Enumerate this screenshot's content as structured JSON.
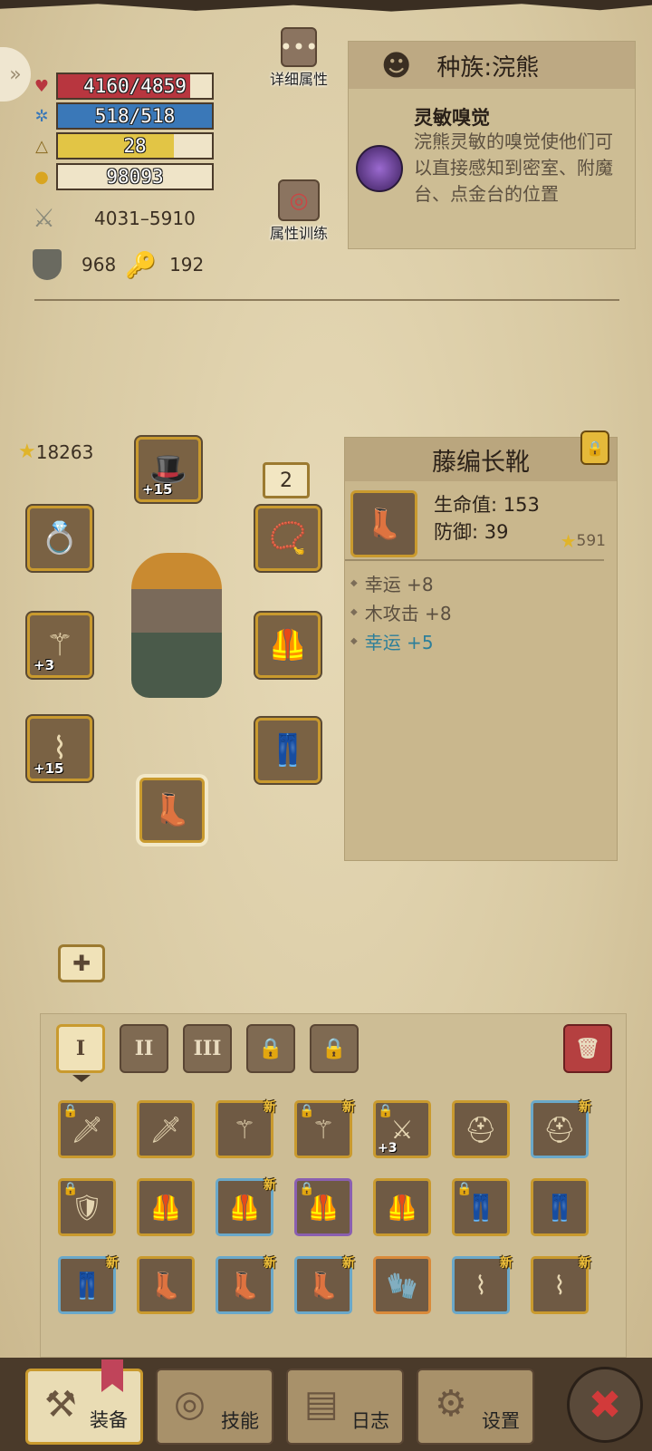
{
  "stats": {
    "hp": {
      "text": "4160/4859",
      "fraction": 0.856,
      "color": "#b8363f"
    },
    "mp": {
      "text": "518/518",
      "fraction": 1.0,
      "color": "#3a78b8"
    },
    "level": {
      "text": "28",
      "fraction": 0.75,
      "color": "#e2c545"
    },
    "gold": {
      "text": "98093"
    },
    "attack": "4031–5910",
    "armor": "968",
    "resist": "192"
  },
  "buttons": {
    "detail_attrs": "详细属性",
    "attr_training": "属性训练",
    "detail_icon": "•••"
  },
  "race": {
    "title": "种族:浣熊",
    "skill_name": "灵敏嗅觉",
    "skill_desc": "浣熊灵敏的嗅觉使他们可以直接感知到密室、附魔台、点金台的位置"
  },
  "character": {
    "power": "18263",
    "level_badge": "2"
  },
  "equipment_slots": [
    {
      "slot": "head",
      "icon": "hat-icon",
      "plus": "+15"
    },
    {
      "slot": "ring",
      "icon": "ring-icon",
      "plus": ""
    },
    {
      "slot": "necklace",
      "icon": "necklace-icon",
      "plus": ""
    },
    {
      "slot": "weapon",
      "icon": "staff-icon",
      "plus": "+3"
    },
    {
      "slot": "armor",
      "icon": "armor-icon",
      "plus": ""
    },
    {
      "slot": "bracer",
      "icon": "bracer-icon",
      "plus": "+15"
    },
    {
      "slot": "legs",
      "icon": "pants-icon",
      "plus": ""
    },
    {
      "slot": "boots",
      "icon": "boots-icon",
      "plus": ""
    }
  ],
  "selected_item": {
    "name": "藤编长靴",
    "stat1": "生命值: 153",
    "stat2": "防御: 39",
    "score": "591",
    "affixes": [
      "幸运 +8",
      "木攻击 +8",
      "幸运 +5"
    ]
  },
  "inventory": {
    "tabs": [
      "I",
      "II",
      "III"
    ],
    "new_label": "新",
    "items": [
      {
        "icon": "sword-icon",
        "border": "gold",
        "locked": true,
        "new": false,
        "plus": ""
      },
      {
        "icon": "sword-icon",
        "border": "gold",
        "locked": false,
        "new": false,
        "plus": ""
      },
      {
        "icon": "staff-icon",
        "border": "gold",
        "locked": false,
        "new": true,
        "plus": ""
      },
      {
        "icon": "staff-icon",
        "border": "gold",
        "locked": true,
        "new": true,
        "plus": ""
      },
      {
        "icon": "blade-icon",
        "border": "gold",
        "locked": true,
        "new": false,
        "plus": "+3"
      },
      {
        "icon": "helmet-icon",
        "border": "gold",
        "locked": false,
        "new": false,
        "plus": ""
      },
      {
        "icon": "helmet-icon",
        "border": "blue",
        "locked": false,
        "new": true,
        "plus": ""
      },
      {
        "icon": "pauldron-icon",
        "border": "gold",
        "locked": true,
        "new": false,
        "plus": ""
      },
      {
        "icon": "armor-icon",
        "border": "gold",
        "locked": false,
        "new": false,
        "plus": ""
      },
      {
        "icon": "armor-icon",
        "border": "blue",
        "locked": false,
        "new": true,
        "plus": ""
      },
      {
        "icon": "armor-icon",
        "border": "purple",
        "locked": true,
        "new": false,
        "plus": ""
      },
      {
        "icon": "armor-icon",
        "border": "gold",
        "locked": false,
        "new": false,
        "plus": ""
      },
      {
        "icon": "pants-icon",
        "border": "gold",
        "locked": true,
        "new": false,
        "plus": ""
      },
      {
        "icon": "pants-icon",
        "border": "gold",
        "locked": false,
        "new": false,
        "plus": ""
      },
      {
        "icon": "pants-icon",
        "border": "blue",
        "locked": false,
        "new": true,
        "plus": ""
      },
      {
        "icon": "boots-icon",
        "border": "gold",
        "locked": false,
        "new": false,
        "plus": ""
      },
      {
        "icon": "boots-icon",
        "border": "blue",
        "locked": false,
        "new": true,
        "plus": ""
      },
      {
        "icon": "boots-icon",
        "border": "blue",
        "locked": false,
        "new": true,
        "plus": ""
      },
      {
        "icon": "gauntlet-icon",
        "border": "orange",
        "locked": false,
        "new": false,
        "plus": ""
      },
      {
        "icon": "bracer-icon",
        "border": "blue",
        "locked": false,
        "new": true,
        "plus": ""
      },
      {
        "icon": "bracer-icon",
        "border": "gold",
        "locked": false,
        "new": true,
        "plus": ""
      }
    ]
  },
  "nav": {
    "equip": "装备",
    "skills": "技能",
    "log": "日志",
    "settings": "设置"
  }
}
